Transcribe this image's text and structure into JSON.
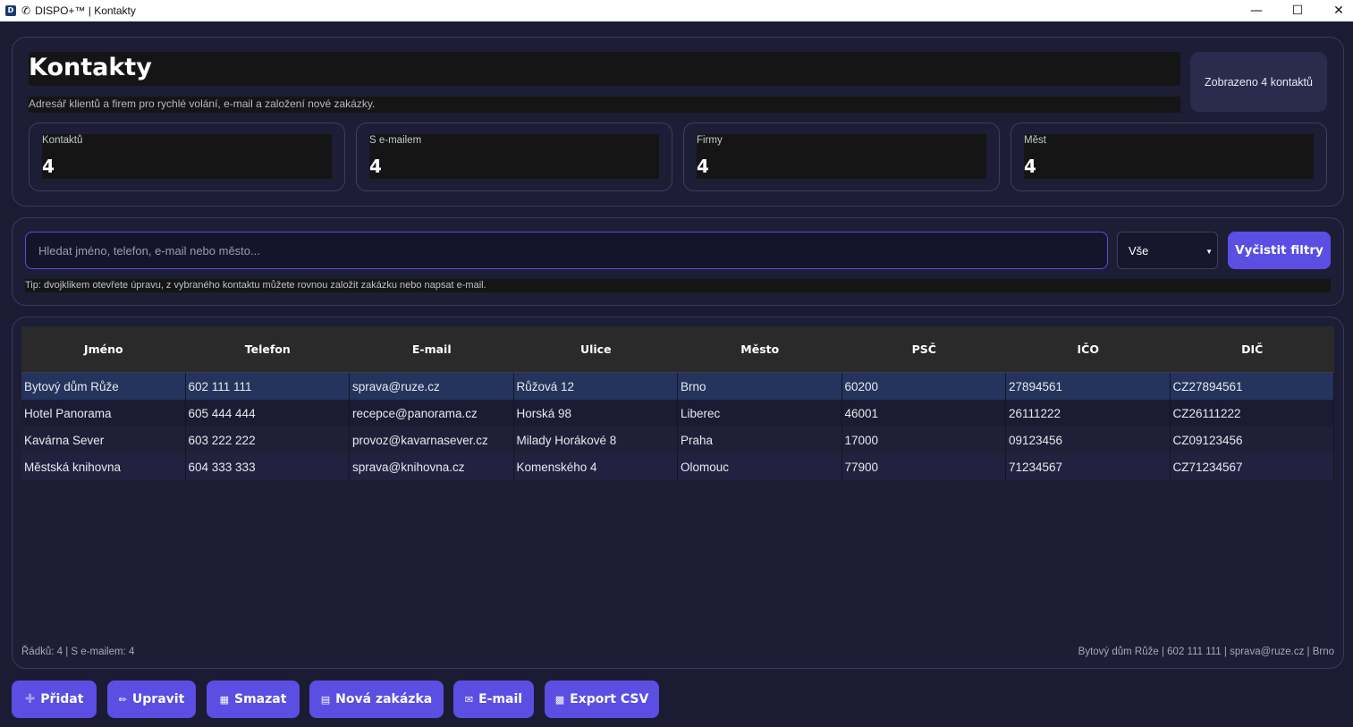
{
  "window": {
    "title": "DISPO+™ | Kontakty",
    "minimize": "—",
    "maximize": "☐",
    "close": "✕"
  },
  "header": {
    "title": "Kontakty",
    "subtitle": "Adresář klientů a firem pro rychlé volání, e-mail a založení nové zakázky.",
    "count_badge": "Zobrazeno 4 kontaktů"
  },
  "stats": [
    {
      "label": "Kontaktů",
      "value": "4"
    },
    {
      "label": "S e-mailem",
      "value": "4"
    },
    {
      "label": "Firmy",
      "value": "4"
    },
    {
      "label": "Měst",
      "value": "4"
    }
  ],
  "filter": {
    "search_placeholder": "Hledat jméno, telefon, e-mail nebo město...",
    "search_value": "",
    "select_value": "Vše",
    "clear_label": "Vyčistit filtry",
    "tip": "Tip: dvojklikem otevřete úpravu, z vybraného kontaktu můžete rovnou založit zakázku nebo napsat e-mail."
  },
  "table": {
    "columns": [
      "Jméno",
      "Telefon",
      "E-mail",
      "Ulice",
      "Město",
      "PSČ",
      "IČO",
      "DIČ"
    ],
    "rows": [
      [
        "Bytový dům Růže",
        "602 111 111",
        "sprava@ruze.cz",
        "Růžová 12",
        "Brno",
        "60200",
        "27894561",
        "CZ27894561"
      ],
      [
        "Hotel Panorama",
        "605 444 444",
        "recepce@panorama.cz",
        "Horská 98",
        "Liberec",
        "46001",
        "26111222",
        "CZ26111222"
      ],
      [
        "Kavárna Sever",
        "603 222 222",
        "provoz@kavarnasever.cz",
        "Milady Horákové 8",
        "Praha",
        "17000",
        "09123456",
        "CZ09123456"
      ],
      [
        "Městská knihovna",
        "604 333 333",
        "sprava@knihovna.cz",
        "Komenského 4",
        "Olomouc",
        "77900",
        "71234567",
        "CZ71234567"
      ]
    ],
    "selected_row": 0
  },
  "footer": {
    "left": "Řádků: 4 | S e-mailem: 4",
    "right": "Bytový dům Růže | 602 111 111 | sprava@ruze.cz | Brno"
  },
  "actions": {
    "add": "Přidat",
    "edit": "Upravit",
    "delete": "Smazat",
    "new_order": "Nová zakázka",
    "email": "E-mail",
    "export": "Export CSV"
  }
}
